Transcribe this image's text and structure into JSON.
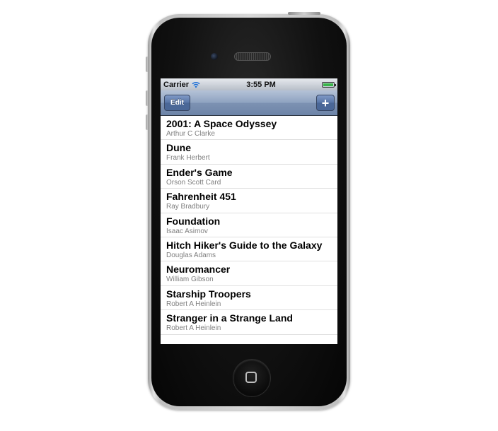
{
  "status_bar": {
    "carrier": "Carrier",
    "time": "3:55 PM",
    "icons": [
      "wifi-icon",
      "battery-icon"
    ]
  },
  "nav_bar": {
    "edit_label": "Edit",
    "add_label": "+"
  },
  "books": [
    {
      "title": "2001: A Space Odyssey",
      "author": "Arthur C Clarke"
    },
    {
      "title": "Dune",
      "author": "Frank Herbert"
    },
    {
      "title": "Ender's Game",
      "author": "Orson Scott Card"
    },
    {
      "title": "Fahrenheit 451",
      "author": "Ray Bradbury"
    },
    {
      "title": "Foundation",
      "author": "Isaac Asimov"
    },
    {
      "title": "Hitch Hiker's Guide to the Galaxy",
      "author": "Douglas Adams"
    },
    {
      "title": "Neuromancer",
      "author": "William Gibson"
    },
    {
      "title": "Starship Troopers",
      "author": "Robert A Heinlein"
    },
    {
      "title": "Stranger in a Strange Land",
      "author": "Robert A Heinlein"
    }
  ],
  "colors": {
    "nav_bar": "#7d92b2",
    "button": "#5774a6",
    "subtitle": "#7f7f7f"
  }
}
